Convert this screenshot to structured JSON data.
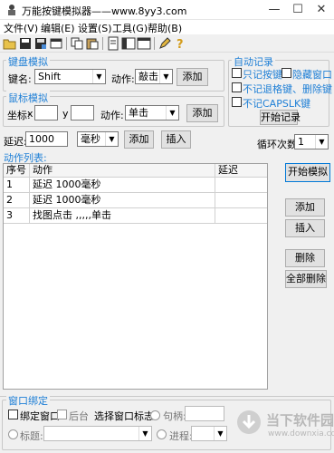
{
  "window": {
    "title": "万能按键模拟器——www.8yy3.com",
    "minimize": "—",
    "maximize": "☐",
    "close": "✕"
  },
  "menu": [
    "文件(V)",
    "编辑(E)",
    "设置(S)",
    "工具(G)",
    "帮助(B)"
  ],
  "toolbar": [
    "open-icon",
    "save-icon",
    "save-as-icon",
    "properties-icon",
    "copy-icon",
    "paste-icon",
    "document-icon",
    "layout-icon",
    "window-icon",
    "edit-pen-icon",
    "help-icon"
  ],
  "keyboard": {
    "legend": "键盘模拟",
    "key_label": "键名:",
    "key_value": "Shift",
    "action_label": "动作:",
    "action_value": "敲击",
    "add": "添加"
  },
  "mouse": {
    "legend": "鼠标模拟",
    "coord_label": "坐标:",
    "x_label": "x",
    "y_label": "y",
    "x_value": "",
    "y_value": "",
    "action_label": "动作:",
    "action_value": "单击",
    "add": "添加"
  },
  "auto_record": {
    "legend": "自动记录",
    "only_keys": "只记按键",
    "hide_window": "隐藏窗口",
    "no_backspace": "不记退格键、删除键",
    "no_capslock": "不记CAPSLK键",
    "start": "开始记录"
  },
  "delay": {
    "label": "延迟:",
    "value": "1000",
    "unit": "毫秒",
    "add": "添加",
    "insert": "插入"
  },
  "loop": {
    "label": "循环次数:",
    "value": "1"
  },
  "actions": {
    "title": "动作列表:",
    "columns": [
      "序号",
      "动作",
      "延迟"
    ],
    "rows": [
      [
        "1",
        "延迟 1000毫秒",
        ""
      ],
      [
        "2",
        "延迟 1000毫秒",
        ""
      ],
      [
        "3",
        "找图点击 ,,,,,单击",
        ""
      ]
    ]
  },
  "side_buttons": {
    "start_sim": "开始模拟",
    "add": "添加",
    "insert": "插入",
    "delete": "删除",
    "delete_all": "全部删除"
  },
  "bind": {
    "legend": "窗口绑定",
    "bind_window": "绑定窗口",
    "background": "后台",
    "choose_label": "选择窗口标志:",
    "handle_label": "句柄:",
    "title_label": "标题:",
    "process_label": "进程:"
  },
  "watermark": "当下软件园",
  "watermark_url": "www.downxia.com"
}
